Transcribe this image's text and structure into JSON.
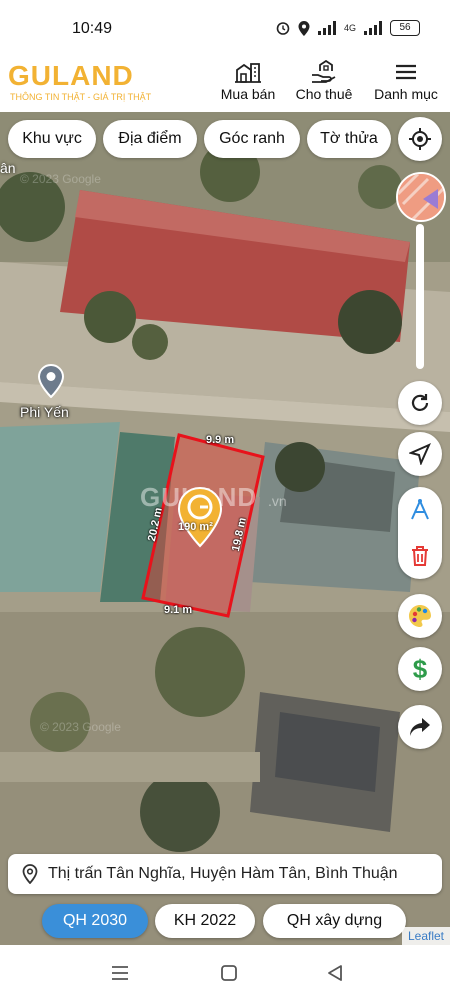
{
  "status": {
    "time": "10:49",
    "network": "4G",
    "battery": "56"
  },
  "header": {
    "logo_text": "GULAND",
    "logo_tagline": "THÔNG TIN THẬT - GIÁ TRỊ THẬT",
    "nav": [
      {
        "label": "Mua bán",
        "icon": "building-icon"
      },
      {
        "label": "Cho thuê",
        "icon": "hand-house-icon"
      },
      {
        "label": "Danh mục",
        "icon": "menu-icon"
      }
    ]
  },
  "filters": [
    "Khu vực",
    "Địa điểm",
    "Góc ranh",
    "Tờ thửa"
  ],
  "map": {
    "corner_text": "ân",
    "poi_label": "Phi Yến",
    "watermark": "GULAND",
    "watermark_suffix": ".vn",
    "google_watermark": "© 2023 Google",
    "parcel": {
      "area": "190 m²",
      "edge_top": "9.9 m",
      "edge_right": "19.8 m",
      "edge_bottom": "9.1 m",
      "edge_left": "20.2 m",
      "outline_color": "#e8121b"
    }
  },
  "side_buttons": [
    "locate-icon",
    "refresh-icon",
    "navigate-icon",
    "measure-icon",
    "trash-icon",
    "palette-icon",
    "price-icon",
    "share-icon"
  ],
  "address": "Thị trấn Tân Nghĩa, Huyện Hàm Tân, Bình Thuận",
  "layers": [
    {
      "label": "QH 2030",
      "active": true
    },
    {
      "label": "KH 2022",
      "active": false
    },
    {
      "label": "QH xây dựng",
      "active": false
    }
  ],
  "attribution": "Leaflet",
  "colors": {
    "brand": "#f2b233",
    "accent": "#3a8fd9",
    "parcel": "#e8121b"
  }
}
